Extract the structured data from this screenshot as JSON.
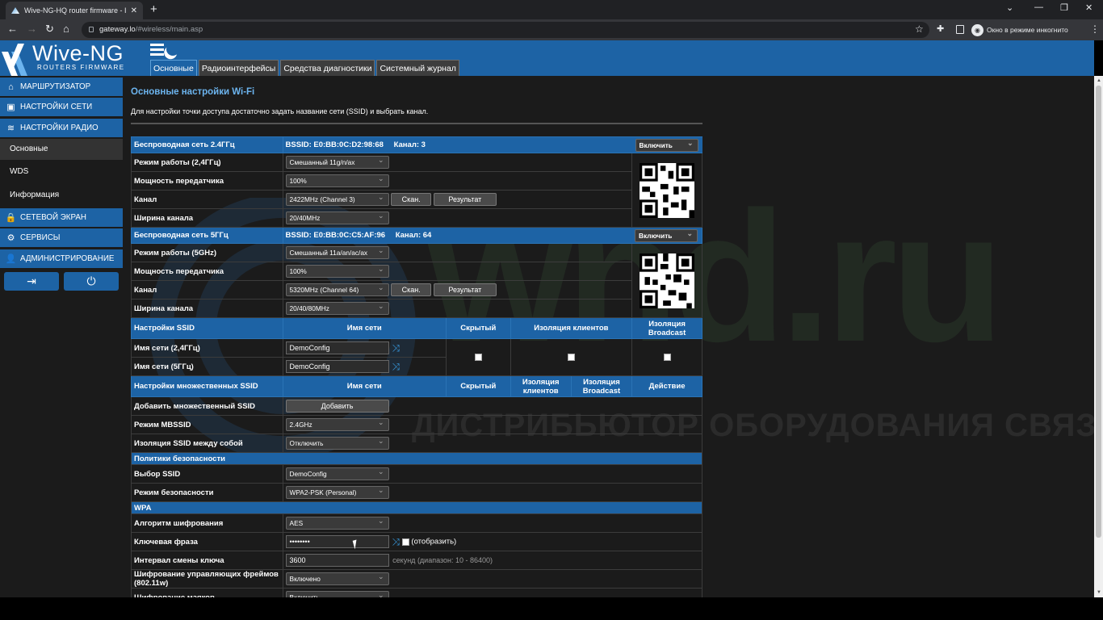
{
  "browser": {
    "tab_title": "Wive-NG-HQ router firmware - Ir",
    "url_host": "gateway.lo",
    "url_path": "/#wireless/main.asp",
    "incognito_label": "Окно в режиме инкогнито"
  },
  "header": {
    "logo_name": "Wive-NG",
    "logo_sub": "ROUTERS FIRMWARE",
    "tabs": [
      {
        "label": "Основные",
        "active": true
      },
      {
        "label": "Радиоинтерфейсы"
      },
      {
        "label": "Средства диагностики"
      },
      {
        "label": "Системный журнал"
      }
    ]
  },
  "sidebar": {
    "items": [
      {
        "label": "МАРШРУТИЗАТОР",
        "icon": "home-icon"
      },
      {
        "label": "НАСТРОЙКИ СЕТИ",
        "icon": "network-icon"
      },
      {
        "label": "НАСТРОЙКИ РАДИО",
        "icon": "wifi-icon"
      },
      {
        "label": "СЕТЕВОЙ ЭКРАН",
        "icon": "lock-icon"
      },
      {
        "label": "СЕРВИСЫ",
        "icon": "gear-icon"
      },
      {
        "label": "АДМИНИСТРИРОВАНИЕ",
        "icon": "admin-icon"
      }
    ],
    "subitems": [
      "Основные",
      "WDS",
      "Информация"
    ]
  },
  "watermark": {
    "brand": "wnd.ru",
    "tagline": "ДИСТРИБЬЮТОР ОБОРУДОВАНИЯ СВЯЗИ"
  },
  "content": {
    "title": "Основные настройки Wi-Fi",
    "description": "Для настройки точки доступа достаточно задать название сети (SSID) и выбрать канал.",
    "band24": {
      "header": "Беспроводная сеть 2.4ГГц",
      "bssid": "BSSID: E0:BB:0C:D2:98:68",
      "channel_info": "Канал: 3",
      "enable": "Включить",
      "mode_label": "Режим работы (2,4ГГц)",
      "mode_value": "Смешанный 11g/n/ax",
      "power_label": "Мощность передатчика",
      "power_value": "100%",
      "channel_label": "Канал",
      "channel_value": "2422MHz (Channel 3)",
      "width_label": "Ширина канала",
      "width_value": "20/40MHz"
    },
    "band5": {
      "header": "Беспроводная сеть 5ГГц",
      "bssid": "BSSID: E0:BB:0C:C5:AF:96",
      "channel_info": "Канал: 64",
      "enable": "Включить",
      "mode_label": "Режим работы (5GHz)",
      "mode_value": "Смешанный 11a/an/ac/ax",
      "power_label": "Мощность передатчика",
      "power_value": "100%",
      "channel_label": "Канал",
      "channel_value": "5320MHz (Channel 64)",
      "width_label": "Ширина канала",
      "width_value": "20/40/80MHz"
    },
    "scan_label": "Скан.",
    "result_label": "Результат",
    "ssid": {
      "header": "Настройки SSID",
      "col_name": "Имя сети",
      "col_hidden": "Скрытый",
      "col_isolation": "Изоляция клиентов",
      "col_broadcast": "Изоляция Broadcast",
      "row24_label": "Имя сети (2,4ГГц)",
      "row24_value": "DemoConfig",
      "row5_label": "Имя сети (5ГГц)",
      "row5_value": "DemoConfig"
    },
    "mbssid": {
      "header": "Настройки множественных SSID",
      "col_name": "Имя сети",
      "col_hidden": "Скрытый",
      "col_isolation": "Изоляция клиентов",
      "col_broadcast": "Изоляция Broadcast",
      "col_action": "Действие",
      "add_label": "Добавить множественный SSID",
      "add_button": "Добавить",
      "mode_label": "Режим MBSSID",
      "mode_value": "2.4GHz",
      "isolation_label": "Изоляция SSID между собой",
      "isolation_value": "Отключить"
    },
    "security": {
      "header": "Политики безопасности",
      "ssid_label": "Выбор SSID",
      "ssid_value": "DemoConfig",
      "mode_label": "Режим безопасности",
      "mode_value": "WPA2-PSK (Personal)"
    },
    "wpa": {
      "header": "WPA",
      "alg_label": "Алгоритм шифрования",
      "alg_value": "AES",
      "key_label": "Ключевая фраза",
      "key_value": "••••••••",
      "show_label": "(отобразить)",
      "interval_label": "Интервал смены ключа",
      "interval_value": "3600",
      "interval_hint": "секунд (диапазон: 10 - 86400)",
      "pmf_label": "Шифрование управляющих фреймов (802.11w)",
      "pmf_value": "Включено",
      "beacon_label": "Шифрование маяков",
      "beacon_value": "Включить"
    }
  }
}
